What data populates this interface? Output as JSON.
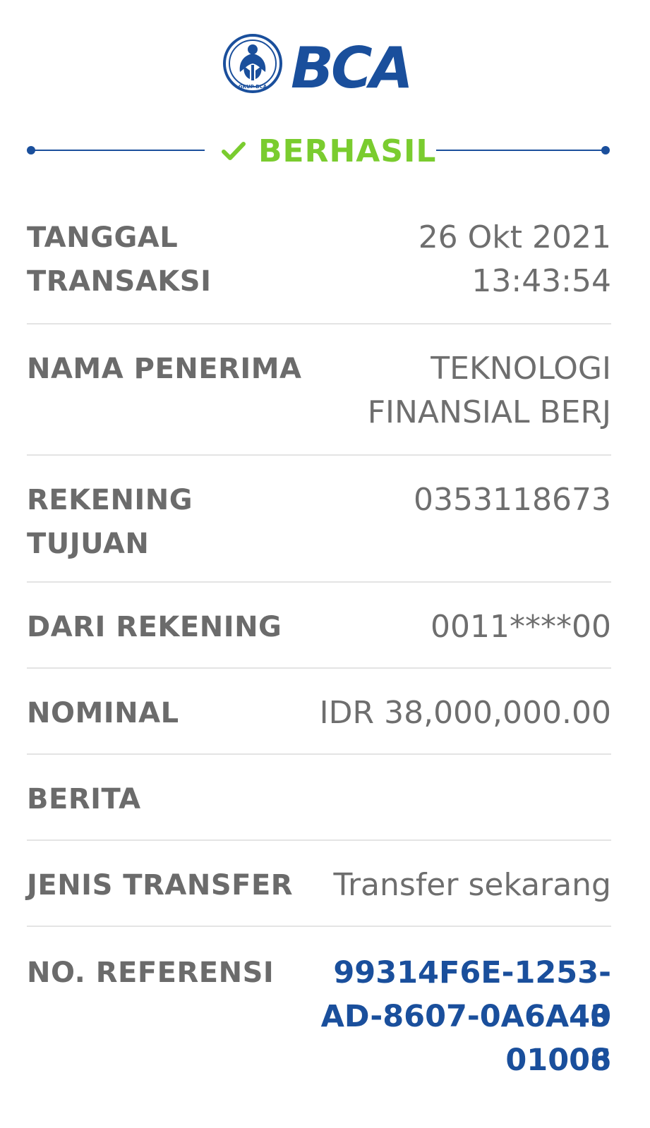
{
  "header": {
    "logo_text": "BCA",
    "logo_subtext": "GRUP BCA",
    "brand_color": "#1a4f9c"
  },
  "status": {
    "icon": "check-icon",
    "label": "BERHASIL",
    "color": "#7acc2f"
  },
  "details": {
    "tanggal_label": "TANGGAL TRANSAKSI",
    "tanggal_date": "26 Okt 2021",
    "tanggal_time": "13:43:54",
    "penerima_label": "NAMA PENERIMA",
    "penerima_line1": "TEKNOLOGI",
    "penerima_line2": "FINANSIAL BERJ",
    "rekening_tujuan_label": "REKENING TUJUAN",
    "rekening_tujuan_value": "0353118673",
    "dari_rekening_label": "DARI REKENING",
    "dari_rekening_value": "0011****00",
    "nominal_label": "NOMINAL",
    "nominal_value": "IDR 38,000,000.00",
    "berita_label": "BERITA",
    "berita_value": "",
    "jenis_transfer_label": "JENIS TRANSFER",
    "jenis_transfer_value": "Transfer sekarang",
    "referensi_label": "NO. REFERENSI",
    "referensi_line1": "99314F6E-1253-40",
    "referensi_line2": "AD-8607-0A6A436",
    "referensi_line3": "01008"
  }
}
